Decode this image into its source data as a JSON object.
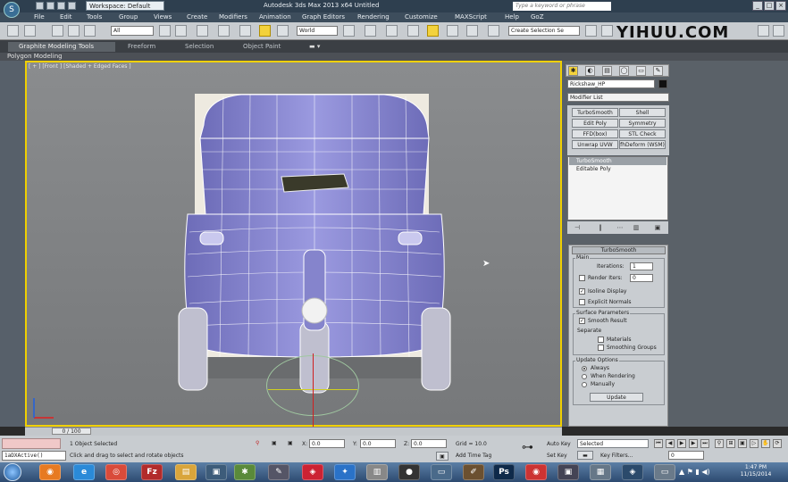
{
  "title_bar": {
    "workspace": "Workspace: Default",
    "window_title": "Autodesk 3ds Max  2013 x64      Untitled",
    "search_placeholder": "Type a keyword or phrase"
  },
  "menu": [
    "File",
    "Edit",
    "Tools",
    "Group",
    "Views",
    "Create",
    "Modifiers",
    "Animation",
    "Graph Editors",
    "Rendering",
    "Customize",
    "MAXScript",
    "Help",
    "GoZ"
  ],
  "toolbar": {
    "selection_filter": "All",
    "ref_coord": "World",
    "named_selection": "Create Selection Se"
  },
  "watermark": "YIHUU.COM",
  "ribbon": {
    "tabs": [
      "Graphite Modeling Tools",
      "Freeform",
      "Selection",
      "Object Paint"
    ],
    "sub_label": "Polygon Modeling"
  },
  "viewport": {
    "label": "[ + ] [Front ] [Shaded + Edged Faces ]"
  },
  "command_panel": {
    "object_name": "Rickshaw_HP",
    "modifier_list": "Modifier List",
    "modifier_buttons": [
      "TurboSmooth",
      "Shell",
      "Edit Poly",
      "Symmetry",
      "FFD(box)",
      "STL Check",
      "Unwrap UVW",
      "fhDeform (WSM)"
    ],
    "stack": [
      "TurboSmooth",
      "Editable Poly"
    ],
    "rollout": {
      "title": "TurboSmooth",
      "main_label": "Main",
      "iterations_label": "Iterations:",
      "iterations_value": "1",
      "render_iters_label": "Render Iters:",
      "render_iters_value": "0",
      "isoline_label": "Isoline Display",
      "explicit_normals_label": "Explicit Normals",
      "surface_label": "Surface Parameters",
      "smooth_result_label": "Smooth Result",
      "separate_label": "Separate",
      "materials_label": "Materials",
      "smoothing_groups_label": "Smoothing Groups",
      "update_options_label": "Update Options",
      "always_label": "Always",
      "when_rendering_label": "When Rendering",
      "manually_label": "Manually",
      "update_button": "Update"
    }
  },
  "timeline": {
    "frame": "0 / 100"
  },
  "status": {
    "maxscript": "1aDXActive()",
    "selected": "1 Object Selected",
    "prompt": "Click and drag to select and rotate objects",
    "x_label": "X:",
    "x_value": "0.0",
    "y_label": "Y:",
    "y_value": "0.0",
    "z_label": "Z:",
    "z_value": "0.0",
    "grid": "Grid = 10.0",
    "add_time_tag": "Add Time Tag",
    "auto_key": "Auto Key",
    "set_key": "Set Key",
    "selected_dd": "Selected",
    "key_filters": "Key Filters...",
    "frame_value": "0"
  },
  "taskbar": {
    "time": "1:47 PM",
    "date": "11/15/2014"
  },
  "colors": {
    "viewport_border": "#f0d000",
    "model_fill": "#8f8ed6",
    "wire": "#ffffff"
  }
}
